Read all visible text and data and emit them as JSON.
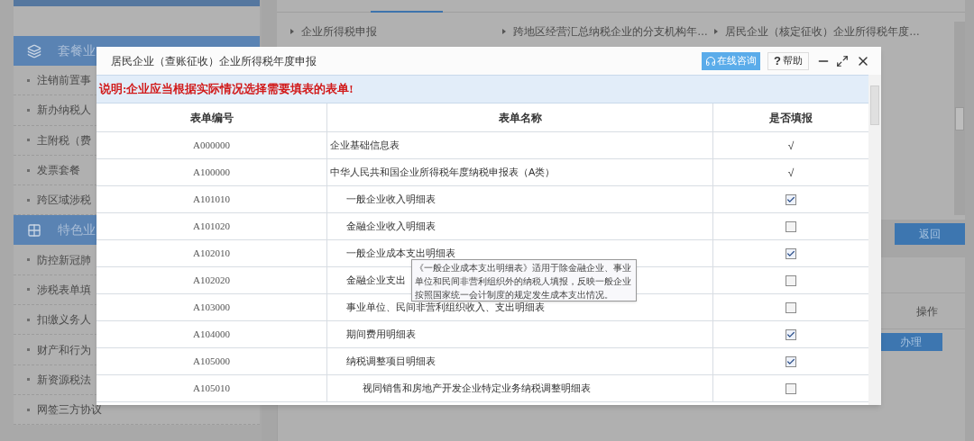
{
  "sidebar": {
    "sections": [
      {
        "title": "套餐业",
        "items": [
          "注销前置事",
          "新办纳税人",
          "主附税（费",
          "发票套餐",
          "跨区域涉税"
        ]
      },
      {
        "title": "特色业",
        "items": [
          "防控新冠肺",
          "涉税表单填",
          "扣缴义务人",
          "财产和行为",
          "新资源税法",
          "网签三方协议"
        ]
      }
    ]
  },
  "links": [
    "企业所得税申报",
    "跨地区经营汇总纳税企业的分支机构年…",
    "居民企业（核定征收）企业所得税年度…"
  ],
  "back_button": "返回",
  "lower_table": {
    "header": "操作",
    "action_button": "办理"
  },
  "dialog": {
    "title": "居民企业（查账征收）企业所得税年度申报",
    "consult_button": "在线咨询",
    "help_icon_char": "?",
    "help_button": "帮助",
    "notice": "说明:企业应当根据实际情况选择需要填表的表单!",
    "columns": [
      "表单编号",
      "表单名称",
      "是否填报"
    ],
    "rows": [
      {
        "code": "A000000",
        "name": "企业基础信息表",
        "kind": "mark",
        "mark": "√"
      },
      {
        "code": "A100000",
        "name": "中华人民共和国企业所得税年度纳税申报表（A类）",
        "kind": "mark",
        "mark": "√",
        "children": [
          {
            "code": "A101010",
            "name": "一般企业收入明细表",
            "kind": "checkbox",
            "checked": true
          },
          {
            "code": "A101020",
            "name": "金融企业收入明细表",
            "kind": "checkbox",
            "checked": false
          },
          {
            "code": "A102010",
            "name": "一般企业成本支出明细表",
            "kind": "checkbox",
            "checked": true
          },
          {
            "code": "A102020",
            "name": "金融企业支出",
            "kind": "checkbox",
            "checked": false
          },
          {
            "code": "A103000",
            "name": "事业单位、民间非营利组织收入、支出明细表",
            "kind": "checkbox",
            "checked": false
          },
          {
            "code": "A104000",
            "name": "期间费用明细表",
            "kind": "checkbox",
            "checked": true
          },
          {
            "code": "A105000",
            "name": "纳税调整项目明细表",
            "kind": "checkbox",
            "checked": true,
            "children": [
              {
                "code": "A105010",
                "name": "视同销售和房地产开发企业特定业务纳税调整明细表",
                "kind": "checkbox",
                "checked": false
              }
            ]
          }
        ]
      }
    ],
    "tooltip": "《一般企业成本支出明细表》适用于除金融企业、事业单位和民间非营利组织外的纳税人填报，反映一般企业按照国家统一会计制度的规定发生成本支出情况。"
  }
}
